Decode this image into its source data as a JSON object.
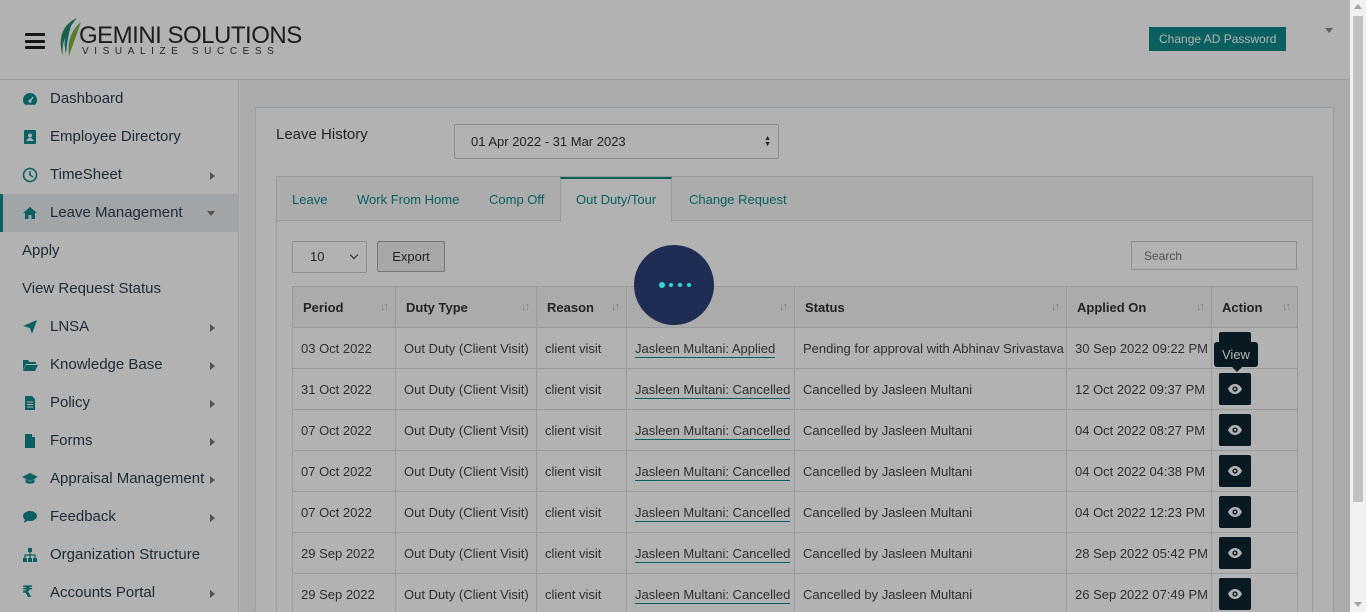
{
  "header": {
    "logo_main": "GEMINI SOLUTIONS",
    "logo_tagline": "VISUALIZE SUCCESS",
    "change_password_label": "Change AD Password"
  },
  "sidebar": {
    "items": [
      {
        "label": "Dashboard",
        "icon": "dashboard-icon",
        "has_arrow": false
      },
      {
        "label": "Employee Directory",
        "icon": "address-book-icon",
        "has_arrow": false
      },
      {
        "label": "TimeSheet",
        "icon": "clock-icon",
        "has_arrow": true
      },
      {
        "label": "Leave Management",
        "icon": "home-icon",
        "has_arrow": true,
        "active": true
      },
      {
        "label": "LNSA",
        "icon": "paper-plane-icon",
        "has_arrow": true
      },
      {
        "label": "Knowledge Base",
        "icon": "folder-open-icon",
        "has_arrow": true
      },
      {
        "label": "Policy",
        "icon": "file-text-icon",
        "has_arrow": true
      },
      {
        "label": "Forms",
        "icon": "file-icon",
        "has_arrow": true
      },
      {
        "label": "Appraisal Management",
        "icon": "graduation-cap-icon",
        "has_arrow": true
      },
      {
        "label": "Feedback",
        "icon": "comments-icon",
        "has_arrow": true
      },
      {
        "label": "Organization Structure",
        "icon": "sitemap-icon",
        "has_arrow": false
      },
      {
        "label": "Accounts Portal",
        "icon": "rupee-icon",
        "has_arrow": true
      }
    ],
    "submenu": [
      "Apply",
      "View Request Status"
    ]
  },
  "main": {
    "title": "Leave History",
    "fy_selected": "01 Apr 2022 - 31 Mar 2023",
    "tabs": [
      "Leave",
      "Work From Home",
      "Comp Off",
      "Out Duty/Tour",
      "Change Request"
    ],
    "active_tab": "Out Duty/Tour",
    "page_length": "10",
    "export_label": "Export",
    "search_placeholder": "Search",
    "columns": [
      "Period",
      "Duty Type",
      "Reason",
      "",
      "Status",
      "Applied On",
      "Action"
    ],
    "rows": [
      {
        "period": "03 Oct 2022",
        "duty_type": "Out Duty (Client Visit)",
        "reason": "client visit",
        "approver": "Jasleen Multani: Applied",
        "status": "Pending for approval with Abhinav Srivastava",
        "applied_on": "30 Sep 2022 09:22 PM"
      },
      {
        "period": "31 Oct 2022",
        "duty_type": "Out Duty (Client Visit)",
        "reason": "client visit",
        "approver": "Jasleen Multani: Cancelled",
        "status": "Cancelled by Jasleen Multani",
        "applied_on": "12 Oct 2022 09:37 PM"
      },
      {
        "period": "07 Oct 2022",
        "duty_type": "Out Duty (Client Visit)",
        "reason": "client visit",
        "approver": "Jasleen Multani: Cancelled",
        "status": "Cancelled by Jasleen Multani",
        "applied_on": "04 Oct 2022 08:27 PM"
      },
      {
        "period": "07 Oct 2022",
        "duty_type": "Out Duty (Client Visit)",
        "reason": "client visit",
        "approver": "Jasleen Multani: Cancelled",
        "status": "Cancelled by Jasleen Multani",
        "applied_on": "04 Oct 2022 04:38 PM"
      },
      {
        "period": "07 Oct 2022",
        "duty_type": "Out Duty (Client Visit)",
        "reason": "client visit",
        "approver": "Jasleen Multani: Cancelled",
        "status": "Cancelled by Jasleen Multani",
        "applied_on": "04 Oct 2022 12:23 PM"
      },
      {
        "period": "29 Sep 2022",
        "duty_type": "Out Duty (Client Visit)",
        "reason": "client visit",
        "approver": "Jasleen Multani: Cancelled",
        "status": "Cancelled by Jasleen Multani",
        "applied_on": "28 Sep 2022 05:42 PM"
      },
      {
        "period": "29 Sep 2022",
        "duty_type": "Out Duty (Client Visit)",
        "reason": "client visit",
        "approver": "Jasleen Multani: Cancelled",
        "status": "Cancelled by Jasleen Multani",
        "applied_on": "26 Sep 2022 07:49 PM"
      }
    ],
    "tooltip": "View"
  },
  "colors": {
    "accent": "#0f8a8a",
    "action_button": "#0c2530",
    "spinner": "#1f2d55"
  }
}
